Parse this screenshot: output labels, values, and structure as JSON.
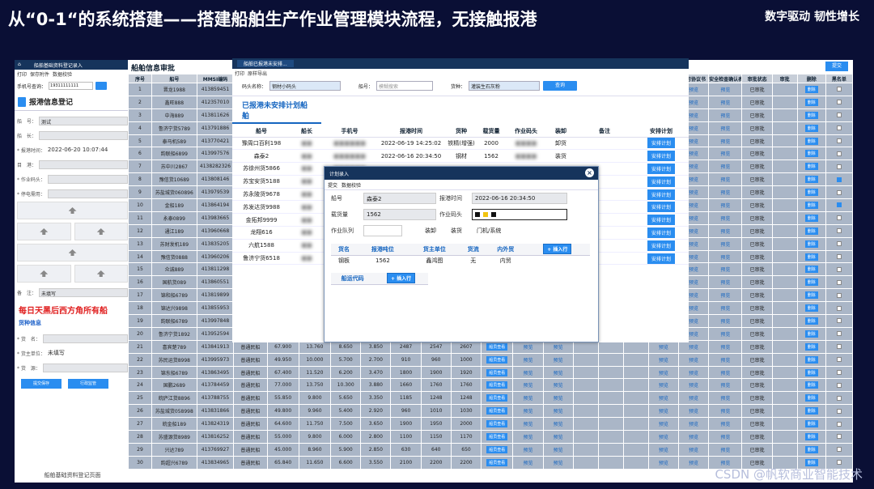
{
  "slide": {
    "title": "从“0-1“的系统搭建——搭建船舶生产作业管理模块流程，无接触报港",
    "slogan": "数字驱动 韧性增长",
    "watermark": "CSDN @帆软商业智能技术"
  },
  "left_panel": {
    "tab_label": "船舶基础资料登记录入",
    "toolbar": {
      "print": "打印",
      "save": "保存附件",
      "check": "数据校验"
    },
    "search_label": "手机号查询：",
    "search_value": "19311111111",
    "section_title": "报港信息登记",
    "fields": [
      {
        "label": "船　号：",
        "value": "测试"
      },
      {
        "label": "船　长：",
        "value": ""
      },
      {
        "label": "* 报港时间：",
        "value": "2022-06-20 10:07:44"
      },
      {
        "label": "目　港：",
        "value": ""
      },
      {
        "label": "* 作业码头：",
        "value": ""
      },
      {
        "label": "* 停电需用：",
        "value": ""
      }
    ],
    "upload_labels": [
      "船舶进行说明（合规）",
      "垃圾学单截图",
      "污水学单截图",
      "污油物运证明（三日内）",
      "垃圾污水上报时间",
      "运单截图",
      "煤/焦面检截图"
    ],
    "remark_label": "备　注：",
    "remark_value": "未填写",
    "notice": "每日天黑后西方角所有船",
    "cargo_section": "货种信息",
    "cargo_fields": [
      {
        "label": "* 货　名：",
        "value": ""
      },
      {
        "label": "* 货主单位：",
        "value": "未填写"
      },
      {
        "label": "* 货　源：",
        "value": ""
      }
    ],
    "buttons": [
      "提交保存",
      "行政监管",
      "打印港内生产单"
    ],
    "footer": "船舶基础资料登记页面"
  },
  "main_panel": {
    "title": "船舶信息审批",
    "top_button": "提交",
    "headers": [
      "序号",
      "船号",
      "MMSI编码",
      "",
      "",
      "",
      "",
      "",
      "",
      "",
      "",
      "",
      "",
      "",
      "",
      "",
      "",
      "",
      "防污协议书",
      "安全检查确认表",
      "审批状态",
      "审批",
      "删除",
      "黑名单"
    ],
    "rows": [
      [
        "1",
        "晋龙1988",
        "413859451",
        "",
        "",
        "",
        "",
        "",
        "",
        "",
        "",
        "预览",
        "预览",
        "预览",
        "",
        "",
        "",
        "预览",
        "预览",
        "预览",
        "已审批",
        "",
        "删除",
        ""
      ],
      [
        "2",
        "鑫旺888",
        "412357010",
        "",
        "",
        "",
        "",
        "",
        "",
        "",
        "",
        "预览",
        "预览",
        "预览",
        "",
        "",
        "",
        "预览",
        "预览",
        "预览",
        "已审批",
        "",
        "删除",
        ""
      ],
      [
        "3",
        "中海889",
        "413811626",
        "",
        "",
        "",
        "",
        "",
        "",
        "",
        "",
        "预览",
        "预览",
        "预览",
        "",
        "",
        "",
        "预览",
        "预览",
        "预览",
        "已审批",
        "",
        "删除",
        ""
      ],
      [
        "4",
        "鲁济宁货5789",
        "413791886",
        "",
        "",
        "",
        "",
        "",
        "",
        "",
        "",
        "预览",
        "预览",
        "预览",
        "",
        "",
        "",
        "预览",
        "预览",
        "预览",
        "已审批",
        "",
        "删除",
        ""
      ],
      [
        "5",
        "泰马机589",
        "413770421",
        "",
        "",
        "",
        "",
        "",
        "",
        "",
        "",
        "预览",
        "预览",
        "预览",
        "",
        "",
        "",
        "预览",
        "预览",
        "预览",
        "已审批",
        "",
        "删除",
        ""
      ],
      [
        "6",
        "韵联船6899",
        "413997576",
        "",
        "",
        "",
        "",
        "",
        "",
        "",
        "",
        "预览",
        "预览",
        "预览",
        "",
        "",
        "",
        "预览",
        "预览",
        "预览",
        "已审批",
        "",
        "删除",
        ""
      ],
      [
        "7",
        "苏中川2867",
        "4138282326",
        "",
        "",
        "",
        "",
        "",
        "",
        "",
        "",
        "预览",
        "预览",
        "预览",
        "",
        "",
        "",
        "预览",
        "预览",
        "预览",
        "已审批",
        "",
        "删除",
        ""
      ],
      [
        "8",
        "豫信货10689",
        "413808146",
        "",
        "",
        "",
        "",
        "",
        "",
        "",
        "",
        "预览",
        "预览",
        "预览",
        "",
        "",
        "",
        "预览",
        "预览",
        "预览",
        "已审批",
        "",
        "删除",
        "on"
      ],
      [
        "9",
        "苏盐城货060896",
        "413979539",
        "",
        "",
        "",
        "",
        "",
        "",
        "",
        "",
        "预览",
        "预览",
        "预览",
        "",
        "",
        "",
        "预览",
        "预览",
        "预览",
        "已审批",
        "",
        "删除",
        ""
      ],
      [
        "10",
        "金船189",
        "413864194",
        "",
        "",
        "",
        "",
        "",
        "",
        "",
        "",
        "预览",
        "预览",
        "预览",
        "",
        "",
        "",
        "预览",
        "预览",
        "预览",
        "已审批",
        "",
        "删除",
        "on"
      ],
      [
        "11",
        "永泰0899",
        "413983665",
        "",
        "",
        "",
        "",
        "",
        "",
        "",
        "",
        "预览",
        "预览",
        "预览",
        "",
        "",
        "",
        "预览",
        "预览",
        "预览",
        "已审批",
        "",
        "删除",
        ""
      ],
      [
        "12",
        "通江189",
        "413960668",
        "",
        "",
        "",
        "",
        "",
        "",
        "",
        "",
        "预览",
        "预览",
        "预览",
        "",
        "",
        "",
        "预览",
        "预览",
        "预览",
        "已审批",
        "",
        "删除",
        ""
      ],
      [
        "13",
        "苏财发机189",
        "413835205",
        "",
        "",
        "",
        "",
        "",
        "",
        "",
        "",
        "预览",
        "预览",
        "预览",
        "",
        "",
        "",
        "预览",
        "预览",
        "预览",
        "已审批",
        "",
        "删除",
        ""
      ],
      [
        "14",
        "豫信货0888",
        "413960206",
        "",
        "",
        "",
        "",
        "",
        "",
        "",
        "",
        "预览",
        "预览",
        "预览",
        "",
        "",
        "",
        "预览",
        "预览",
        "预览",
        "已审批",
        "",
        "删除",
        ""
      ],
      [
        "15",
        "众诚889",
        "413811298",
        "",
        "",
        "",
        "",
        "",
        "",
        "",
        "",
        "预览",
        "预览",
        "预览",
        "",
        "",
        "",
        "预览",
        "预览",
        "预览",
        "已审批",
        "",
        "删除",
        ""
      ],
      [
        "16",
        "国航货089",
        "413860551",
        "",
        "",
        "",
        "",
        "",
        "",
        "",
        "",
        "预览",
        "预览",
        "预览",
        "",
        "",
        "",
        "预览",
        "预览",
        "预览",
        "已审批",
        "",
        "删除",
        ""
      ],
      [
        "17",
        "锦和船6789",
        "413819899",
        "",
        "",
        "",
        "",
        "",
        "",
        "",
        "",
        "预览",
        "预览",
        "预览",
        "",
        "",
        "",
        "预览",
        "预览",
        "预览",
        "已审批",
        "",
        "删除",
        ""
      ],
      [
        "18",
        "锦达兴9898",
        "413855953",
        "",
        "",
        "",
        "",
        "",
        "",
        "",
        "",
        "预览",
        "预览",
        "预览",
        "",
        "",
        "",
        "预览",
        "预览",
        "预览",
        "已审批",
        "",
        "删除",
        ""
      ],
      [
        "19",
        "韵联船6789",
        "413997848",
        "",
        "",
        "",
        "",
        "",
        "",
        "",
        "",
        "预览",
        "预览",
        "预览",
        "",
        "",
        "",
        "预览",
        "预览",
        "预览",
        "已审批",
        "",
        "删除",
        ""
      ],
      [
        "20",
        "鲁济宁货1892",
        "413952594",
        "普通民船",
        "42.000",
        "8.300",
        "4.500",
        "2.600",
        "590",
        "590",
        "590",
        "船员查看",
        "预览",
        "预览",
        "",
        "",
        "",
        "预览",
        "预览",
        "预览",
        "已审批",
        "",
        "删除",
        ""
      ],
      [
        "21",
        "喜宾楚789",
        "413841913",
        "普通民船",
        "67.900",
        "13.760",
        "8.650",
        "3.850",
        "2487",
        "2547",
        "2607",
        "船员查看",
        "预览",
        "预览",
        "",
        "",
        "",
        "预览",
        "预览",
        "预览",
        "已审批",
        "",
        "删除",
        ""
      ],
      [
        "22",
        "苏民运货8998",
        "413995973",
        "普通民船",
        "49.950",
        "10.000",
        "5.700",
        "2.700",
        "910",
        "960",
        "1000",
        "船员查看",
        "预览",
        "预览",
        "",
        "",
        "",
        "预览",
        "预览",
        "预览",
        "已审批",
        "",
        "删除",
        ""
      ],
      [
        "23",
        "锦东船6789",
        "413863495",
        "普通民船",
        "67.400",
        "11.520",
        "6.200",
        "3.470",
        "1800",
        "1900",
        "1920",
        "船员查看",
        "预览",
        "预览",
        "",
        "",
        "",
        "预览",
        "预览",
        "预览",
        "已审批",
        "",
        "删除",
        ""
      ],
      [
        "24",
        "国鹏2689",
        "413784459",
        "普通民船",
        "77.000",
        "13.750",
        "10.300",
        "3.880",
        "1660",
        "1760",
        "1760",
        "船员查看",
        "预览",
        "预览",
        "",
        "",
        "",
        "预览",
        "预览",
        "预览",
        "已审批",
        "",
        "删除",
        ""
      ],
      [
        "25",
        "皖庐江货8896",
        "413788755",
        "普通民船",
        "55.850",
        "9.800",
        "5.650",
        "3.350",
        "1185",
        "1248",
        "1248",
        "船员查看",
        "预览",
        "预览",
        "",
        "",
        "",
        "预览",
        "预览",
        "预览",
        "已审批",
        "",
        "删除",
        ""
      ],
      [
        "26",
        "苏盐城货058998",
        "413831866",
        "普通民船",
        "49.800",
        "9.960",
        "5.400",
        "2.920",
        "960",
        "1010",
        "1030",
        "船员查看",
        "预览",
        "预览",
        "",
        "",
        "",
        "预览",
        "预览",
        "预览",
        "已审批",
        "",
        "删除",
        ""
      ],
      [
        "27",
        "皖金船189",
        "413824319",
        "普通民船",
        "64.600",
        "11.750",
        "7.500",
        "3.650",
        "1900",
        "1950",
        "2000",
        "船员查看",
        "预览",
        "预览",
        "",
        "",
        "",
        "预览",
        "预览",
        "预览",
        "已审批",
        "",
        "删除",
        ""
      ],
      [
        "28",
        "苏盛源货8989",
        "413816252",
        "普通民船",
        "55.000",
        "9.800",
        "6.000",
        "2.800",
        "1100",
        "1150",
        "1170",
        "船员查看",
        "预览",
        "预览",
        "",
        "",
        "",
        "预览",
        "预览",
        "预览",
        "已审批",
        "",
        "删除",
        ""
      ],
      [
        "29",
        "兴达789",
        "413769927",
        "普通民船",
        "45.000",
        "8.960",
        "5.900",
        "2.850",
        "630",
        "640",
        "650",
        "船员查看",
        "预览",
        "预览",
        "",
        "",
        "",
        "预览",
        "预览",
        "预览",
        "已审批",
        "",
        "删除",
        ""
      ],
      [
        "30",
        "韵超兴6789",
        "413834965",
        "普通民船",
        "65.840",
        "11.650",
        "6.600",
        "3.550",
        "2100",
        "2200",
        "2200",
        "船员查看",
        "预览",
        "预览",
        "",
        "",
        "",
        "预览",
        "预览",
        "预览",
        "已审批",
        "",
        "删除",
        ""
      ]
    ]
  },
  "schedule_panel": {
    "tab": "船舶已报港未安排...",
    "toolbar": {
      "print": "打印",
      "export": "原样导出"
    },
    "filter": {
      "dock_label": "码头名称：",
      "dock_value": "钢材小码头",
      "ship_label": "船号：",
      "ship_placeholder": "模糊搜索",
      "cargo_label": "货种：",
      "cargo_value": "灌装生石灰粉",
      "query_button": "查询"
    },
    "heading": "已报港未安排计划船舶",
    "headers": [
      "船号",
      "船长",
      "手机号",
      "报港时间",
      "货种",
      "载货量",
      "作业码头",
      "装卸",
      "备注",
      "安排计划"
    ],
    "rows": [
      [
        "豫周口百利198",
        "■■",
        "■■■■■■",
        "2022-06-19 14:25:02",
        "铁精(增强)",
        "2000",
        "■■■■",
        "卸货",
        "",
        "安排计划"
      ],
      [
        "森泰2",
        "■■",
        "■■■■■■",
        "2022-06-16 20:34:50",
        "钢材",
        "1562",
        "■■■■",
        "装货",
        "",
        "安排计划"
      ],
      [
        "苏徐州货5866",
        "■■",
        "■■■■■■",
        "",
        "",
        "",
        "",
        "",
        "",
        "安排计划"
      ],
      [
        "苏宝安货5188",
        "■■",
        "■■■■■■",
        "",
        "",
        "",
        "",
        "",
        "",
        "安排计划"
      ],
      [
        "苏永陵货9678",
        "■■",
        "■■■■■■",
        "",
        "",
        "",
        "",
        "",
        "",
        "安排计划"
      ],
      [
        "苏发达货9988",
        "■■",
        "■■■■■■",
        "",
        "",
        "",
        "",
        "",
        "",
        "安排计划"
      ],
      [
        "金拓邦9999",
        "■■",
        "■■■■■■",
        "",
        "",
        "",
        "",
        "",
        "",
        "安排计划"
      ],
      [
        "龙翔616",
        "■■",
        "■■■■■■",
        "",
        "",
        "",
        "",
        "",
        "",
        "安排计划"
      ],
      [
        "六航1588",
        "■■",
        "■■■■■■",
        "",
        "",
        "",
        "",
        "",
        "",
        "安排计划"
      ],
      [
        "鲁济宁货6518",
        "■■",
        "■■■■■■",
        "",
        "",
        "",
        "",
        "",
        "",
        "安排计划"
      ]
    ]
  },
  "dialog": {
    "title": "计划录入",
    "toolbar": {
      "submit": "提交",
      "check": "数据校验"
    },
    "ship_label": "船号",
    "ship_value": "森泰2",
    "report_time_label": "报港时间",
    "report_time_value": "2022-06-16 20:34:50",
    "load_label": "载货量",
    "load_value": "1562",
    "dock_label": "作业码头",
    "team_label": "作业队列",
    "loadunload_label": "装卸",
    "loadunload_value": "装货",
    "gate_label": "门机/系统",
    "cargo_headers": [
      "货名",
      "报港吨位",
      "货主单位",
      "货流",
      "内外贸"
    ],
    "add_row": "插入行",
    "cargo_row": [
      "钢板",
      "1562",
      "鑫鸿图",
      "无",
      "内贸"
    ],
    "agent_header": "船运代码"
  }
}
